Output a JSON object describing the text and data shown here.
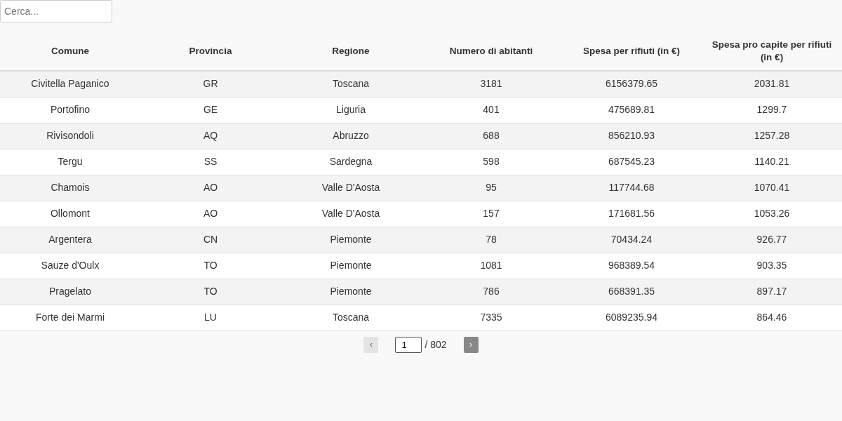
{
  "search": {
    "placeholder": "Cerca..."
  },
  "table": {
    "columns": [
      "Comune",
      "Provincia",
      "Regione",
      "Numero di abitanti",
      "Spesa per rifiuti (in €)",
      "Spesa pro capite per rifiuti (in €)"
    ],
    "rows": [
      [
        "Civitella Paganico",
        "GR",
        "Toscana",
        "3181",
        "6156379.65",
        "2031.81"
      ],
      [
        "Portofino",
        "GE",
        "Liguria",
        "401",
        "475689.81",
        "1299.7"
      ],
      [
        "Rivisondoli",
        "AQ",
        "Abruzzo",
        "688",
        "856210.93",
        "1257.28"
      ],
      [
        "Tergu",
        "SS",
        "Sardegna",
        "598",
        "687545.23",
        "1140.21"
      ],
      [
        "Chamois",
        "AO",
        "Valle D'Aosta",
        "95",
        "117744.68",
        "1070.41"
      ],
      [
        "Ollomont",
        "AO",
        "Valle D'Aosta",
        "157",
        "171681.56",
        "1053.26"
      ],
      [
        "Argentera",
        "CN",
        "Piemonte",
        "78",
        "70434.24",
        "926.77"
      ],
      [
        "Sauze d'Oulx",
        "TO",
        "Piemonte",
        "1081",
        "968389.54",
        "903.35"
      ],
      [
        "Pragelato",
        "TO",
        "Piemonte",
        "786",
        "668391.35",
        "897.17"
      ],
      [
        "Forte dei Marmi",
        "LU",
        "Toscana",
        "7335",
        "6089235.94",
        "864.46"
      ]
    ]
  },
  "pagination": {
    "previous": {
      "label": "‹",
      "disabled": true
    },
    "page": "1",
    "total": "/ 802",
    "next": {
      "label": "›",
      "disabled": false
    }
  }
}
